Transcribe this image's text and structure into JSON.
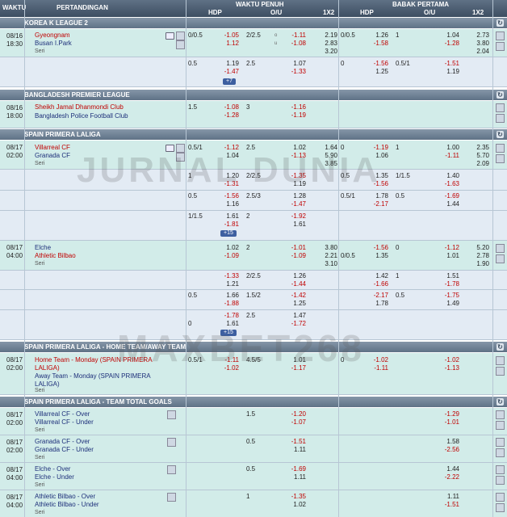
{
  "header": {
    "waktu": "WAKTU",
    "pertandingan": "PERTANDINGAN",
    "full_time": "WAKTU PENUH",
    "first_half": "BABAK PERTAMA",
    "hdp": "HDP",
    "ou": "O/U",
    "x12": "1X2"
  },
  "sections": [
    {
      "title": "KOREA K LEAGUE 2"
    },
    {
      "title": "BANGLADESH PREMIER LEAGUE"
    },
    {
      "title": "SPAIN PRIMERA LALIGA"
    },
    {
      "title": "SPAIN PRIMERA LALIGA - HOME TEAM/AWAY TEAM"
    },
    {
      "title": "SPAIN PRIMERA LALIGA - TEAM TOTAL GOALS"
    }
  ],
  "matches": [
    {
      "date": "08/16",
      "time": "18:30",
      "home": "Gyeongnam",
      "away": "Busan I.Park",
      "draw": "Seri"
    },
    {
      "date": "08/16",
      "time": "18:00",
      "home": "Sheikh Jamal Dhanmondi Club",
      "away": "Bangladesh Police Football Club"
    },
    {
      "date": "08/17",
      "time": "02:00",
      "home": "Villarreal CF",
      "away": "Granada CF",
      "draw": "Seri"
    },
    {
      "date": "08/17",
      "time": "04:00",
      "home": "Elche",
      "away": "Athletic Bilbao",
      "draw": "Seri"
    },
    {
      "date": "08/17",
      "time": "02:00",
      "home": "Home Team - Monday (SPAIN PRIMERA LALIGA)",
      "away": "Away Team - Monday (SPAIN PRIMERA LALIGA)",
      "draw": "Seri"
    },
    {
      "date": "08/17",
      "time": "02:00",
      "home": "Villarreal CF - Over",
      "away": "Villarreal CF - Under",
      "draw": "Seri"
    },
    {
      "date": "08/17",
      "time": "02:00",
      "home": "Granada CF - Over",
      "away": "Granada CF - Under",
      "draw": "Seri"
    },
    {
      "date": "08/17",
      "time": "04:00",
      "home": "Elche - Over",
      "away": "Elche - Under",
      "draw": "Seri"
    },
    {
      "date": "08/17",
      "time": "04:00",
      "home": "Athletic Bilbao - Over",
      "away": "Athletic Bilbao - Under",
      "draw": "Seri"
    }
  ],
  "more": [
    "+7",
    "+15",
    "+15"
  ],
  "watermark": {
    "line1": "JURNAL DUNIA",
    "line2": "MAXBET268"
  },
  "colors": {
    "header": "#4a5b6f",
    "teal_row": "#d2ece9",
    "blue_row": "#e3ebf4",
    "red": "#c00000",
    "navy": "#1d2f7a"
  },
  "odds": [
    [
      "0/0.5",
      "-1.05",
      "1.12",
      "2/2.5",
      "-1.11",
      "-1.08",
      "2.19",
      "2.83",
      "3.20",
      "0/0.5",
      "1.26",
      "-1.58",
      "1",
      "1.04",
      "-1.28",
      "2.73",
      "3.80",
      "2.04"
    ],
    [
      "0.5",
      "1.19",
      "-1.47",
      "2.5",
      "1.07",
      "-1.33",
      "0",
      "-1.56",
      "1.25",
      "0.5/1",
      "-1.51",
      "1.19"
    ],
    [
      "1.5",
      "-1.08",
      "-1.28",
      "3",
      "-1.16",
      "-1.19"
    ],
    [
      "0.5/1",
      "-1.12",
      "1.04",
      "2.5",
      "1.02",
      "-1.13",
      "1.64",
      "5.90",
      "3.85",
      "0",
      "-1.19",
      "1.06",
      "1",
      "1.00",
      "-1.11",
      "2.35",
      "5.70",
      "2.09"
    ],
    [
      "1",
      "1.20",
      "-1.31",
      "2/2.5",
      "-1.35",
      "1.19",
      "0.5",
      "1.35",
      "-1.56",
      "1/1.5",
      "1.40",
      "-1.63"
    ],
    [
      "0.5",
      "-1.56",
      "1.16",
      "2.5/3",
      "1.28",
      "-1.47",
      "0.5/1",
      "1.78",
      "-2.17",
      "0.5",
      "-1.69",
      "1.44"
    ],
    [
      "1/1.5",
      "1.61",
      "-1.81",
      "2",
      "-1.92",
      "1.61"
    ],
    [
      "1.02",
      "-1.09",
      "2",
      "-1.01",
      "-1.09",
      "3.80",
      "2.21",
      "3.10",
      "0/0.5",
      "-1.56",
      "1.35",
      "0",
      "-1.12",
      "1.01",
      "5.20",
      "2.78",
      "1.90"
    ],
    [
      "-1.33",
      "1.21",
      "2/2.5",
      "1.26",
      "-1.44",
      "1.42",
      "-1.66",
      "1",
      "1.51",
      "-1.78"
    ],
    [
      "0.5",
      "1.66",
      "-1.88",
      "1.5/2",
      "-1.42",
      "1.25",
      "-2.17",
      "1.78",
      "0.5",
      "-1.75",
      "1.49"
    ],
    [
      "0",
      "-1.78",
      "1.61",
      "2.5",
      "1.47",
      "-1.72"
    ],
    [
      "0.5/1",
      "-1.11",
      "-1.02",
      "4.5/5",
      "1.01",
      "-1.17",
      "0",
      "-1.02",
      "-1.11",
      "-1.02",
      "-1.13"
    ],
    [
      "1.5",
      "-1.20",
      "-1.07",
      "-1.29",
      "-1.01"
    ],
    [
      "0.5",
      "-1.51",
      "1.11",
      "1.58",
      "-2.56"
    ],
    [
      "0.5",
      "-1.69",
      "1.11",
      "1.44",
      "-2.22"
    ],
    [
      "1",
      "-1.35",
      "1.02",
      "1.11",
      "-1.51"
    ]
  ]
}
